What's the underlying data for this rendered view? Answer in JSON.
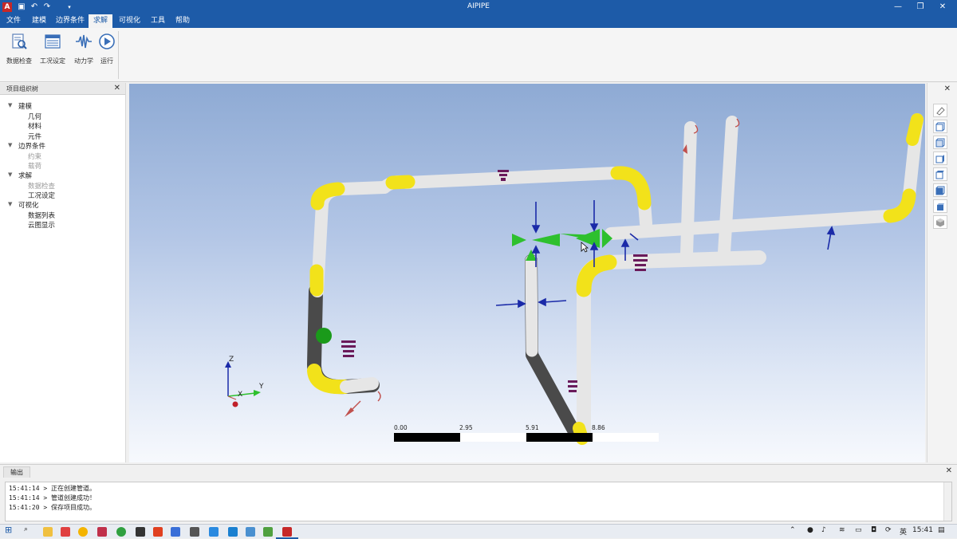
{
  "app": {
    "title": "AIPIPE",
    "icon_letter": "A"
  },
  "window_controls": {
    "minimize": "—",
    "restore": "❐",
    "close": "✕"
  },
  "menu": [
    {
      "label": "文件"
    },
    {
      "label": "建模"
    },
    {
      "label": "边界条件"
    },
    {
      "label": "求解",
      "active": true
    },
    {
      "label": "可视化"
    },
    {
      "label": "工具"
    },
    {
      "label": "帮助"
    }
  ],
  "ribbon": {
    "buttons": [
      {
        "label": "数据检查",
        "icon": "data-check-icon"
      },
      {
        "label": "工况设定",
        "icon": "load-case-icon"
      },
      {
        "label": "动力学",
        "icon": "dynamics-icon"
      },
      {
        "label": "运行",
        "icon": "run-icon"
      }
    ]
  },
  "project_tree": {
    "title": "项目组织树",
    "nodes": [
      {
        "label": "建模",
        "level": 0,
        "expanded": true
      },
      {
        "label": "几何",
        "level": 1
      },
      {
        "label": "材料",
        "level": 1
      },
      {
        "label": "元件",
        "level": 1
      },
      {
        "label": "边界条件",
        "level": 0,
        "expanded": true
      },
      {
        "label": "约束",
        "level": 1,
        "disabled": true
      },
      {
        "label": "载荷",
        "level": 1,
        "disabled": true
      },
      {
        "label": "求解",
        "level": 0,
        "expanded": true
      },
      {
        "label": "数据检查",
        "level": 1,
        "disabled": true
      },
      {
        "label": "工况设定",
        "level": 1
      },
      {
        "label": "可视化",
        "level": 0,
        "expanded": true
      },
      {
        "label": "数据列表",
        "level": 1
      },
      {
        "label": "云图显示",
        "level": 1
      }
    ]
  },
  "viewport": {
    "axes": {
      "z": "Z",
      "x": "X",
      "y": "Y"
    },
    "scale_labels": [
      "0.00",
      "2.95",
      "5.91",
      "8.86"
    ],
    "colors": {
      "pipe": "#e9e9e9",
      "elbow": "#f2e21a",
      "dark": "#4a4a4a",
      "support": "#2ec02e",
      "arrow": "#1a2aa8",
      "hanger": "#6a1a5a"
    }
  },
  "view_tools": [
    {
      "icon": "eraser-icon"
    },
    {
      "icon": "view-front-icon"
    },
    {
      "icon": "view-back-icon"
    },
    {
      "icon": "view-left-icon"
    },
    {
      "icon": "view-right-icon"
    },
    {
      "icon": "view-top-icon"
    },
    {
      "icon": "view-bottom-icon"
    },
    {
      "icon": "view-iso-icon"
    }
  ],
  "output": {
    "tab": "输出",
    "lines": [
      "15:41:14 > 正在创建管道。",
      "15:41:14 > 管道创建成功！",
      "15:41:20 > 保存项目成功。"
    ]
  },
  "taskbar": {
    "ime": "英",
    "clock": "15:41"
  }
}
